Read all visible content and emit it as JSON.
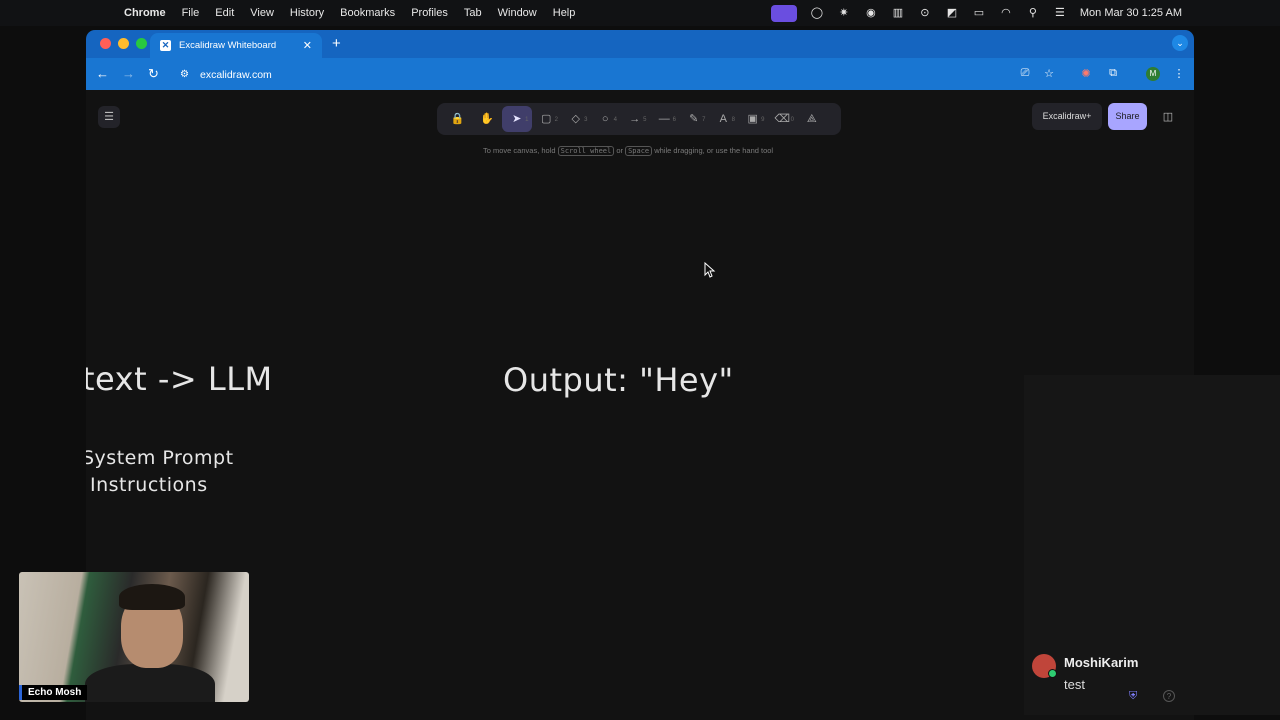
{
  "menubar": {
    "apple": "",
    "app": "Chrome",
    "items": [
      "File",
      "Edit",
      "View",
      "History",
      "Bookmarks",
      "Profiles",
      "Tab",
      "Window",
      "Help"
    ],
    "clock": "Mon Mar 30  1:25 AM"
  },
  "browser": {
    "tab_title": "Excalidraw Whiteboard",
    "url": "excalidraw.com",
    "avatar_letter": "M"
  },
  "excalidraw": {
    "tools": [
      {
        "icon": "lock-icon",
        "glyph": "🔒",
        "key": ""
      },
      {
        "icon": "hand-icon",
        "glyph": "✋",
        "key": ""
      },
      {
        "icon": "selection-icon",
        "glyph": "➤",
        "key": "1"
      },
      {
        "icon": "rectangle-icon",
        "glyph": "▢",
        "key": "2"
      },
      {
        "icon": "diamond-icon",
        "glyph": "◇",
        "key": "3"
      },
      {
        "icon": "ellipse-icon",
        "glyph": "○",
        "key": "4"
      },
      {
        "icon": "arrow-icon",
        "glyph": "→",
        "key": "5"
      },
      {
        "icon": "line-icon",
        "glyph": "—",
        "key": "6"
      },
      {
        "icon": "pencil-icon",
        "glyph": "✎",
        "key": "7"
      },
      {
        "icon": "text-icon",
        "glyph": "A",
        "key": "8"
      },
      {
        "icon": "image-icon",
        "glyph": "▣",
        "key": "9"
      },
      {
        "icon": "eraser-icon",
        "glyph": "⌫",
        "key": "0"
      },
      {
        "icon": "extra-tools-icon",
        "glyph": "⟁",
        "key": ""
      }
    ],
    "hint_before": "To move canvas, hold",
    "hint_key1": "Scroll wheel",
    "hint_or": "or",
    "hint_key2": "Space",
    "hint_after": "while dragging, or use the hand tool",
    "plus_label": "Excalidraw+",
    "share_label": "Share"
  },
  "canvas_text": {
    "line1": "text -> LLM",
    "output": "Output: \"Hey\"",
    "system1": "System Prompt",
    "system2": "Instructions"
  },
  "webcam": {
    "label": "Echo Mosh"
  },
  "collaborator": {
    "name": "MoshiKarim",
    "message": "test"
  }
}
